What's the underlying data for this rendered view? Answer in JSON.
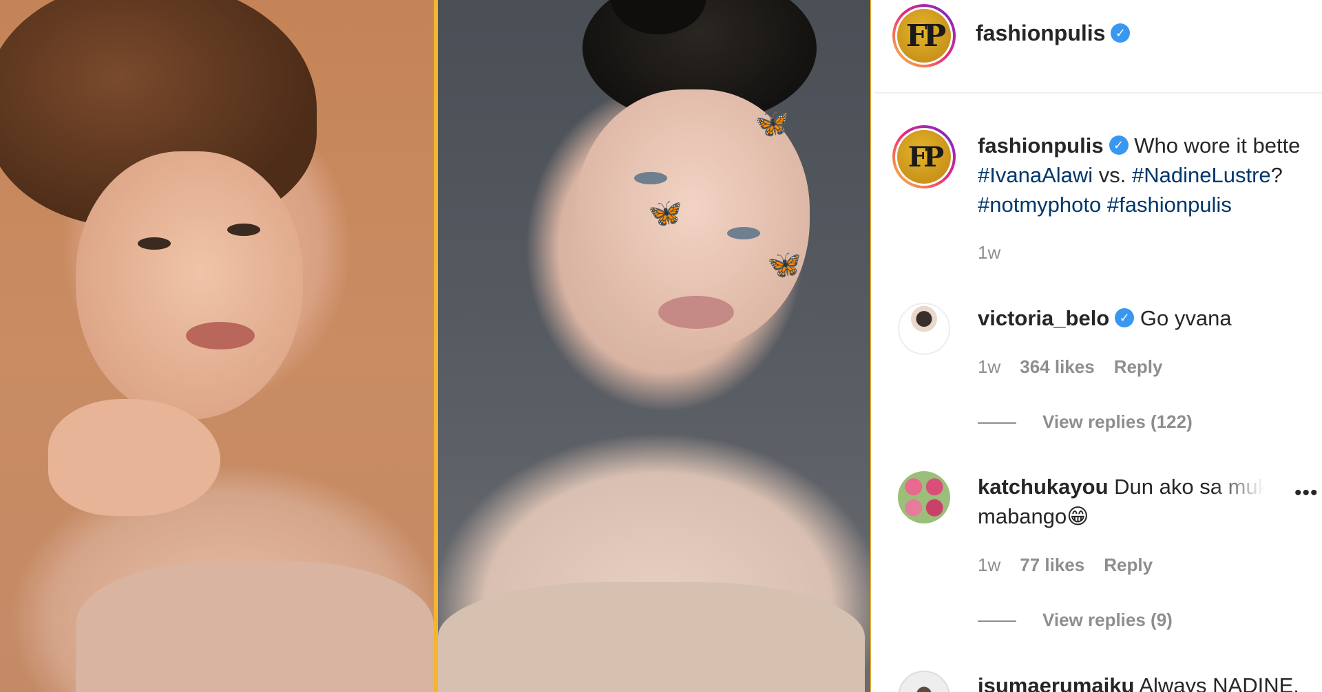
{
  "header": {
    "username": "fashionpulis",
    "verified_icon": "verified-check-icon",
    "avatar_initials": "FP"
  },
  "caption": {
    "username": "fashionpulis",
    "text_start": "Who wore it bette",
    "hashtag_1": "#IvanaAlawi",
    "vs": " vs. ",
    "hashtag_2": "#NadineLustre",
    "question": "?",
    "hashtag_3": "#notmyphoto",
    "hashtag_4": "#fashionpulis",
    "time": "1w"
  },
  "comments": [
    {
      "username": "victoria_belo",
      "verified": true,
      "text": "Go yvana",
      "time": "1w",
      "likes": "364 likes",
      "reply": "Reply",
      "view_replies": "View replies (122)"
    },
    {
      "username": "katchukayou",
      "text": "Dun ako sa mukhan",
      "text_line2": "mabango",
      "emoji": "😁",
      "time": "1w",
      "likes": "77 likes",
      "reply": "Reply",
      "view_replies": "View replies (9)"
    },
    {
      "username": "isumaerumaiku",
      "text": "Always NADINE."
    }
  ],
  "more_icon": "•••",
  "colors": {
    "frame_accent": "#f5b52d",
    "hashtag": "#00376b",
    "verified": "#3897f0",
    "muted_text": "#8e8e8e"
  }
}
